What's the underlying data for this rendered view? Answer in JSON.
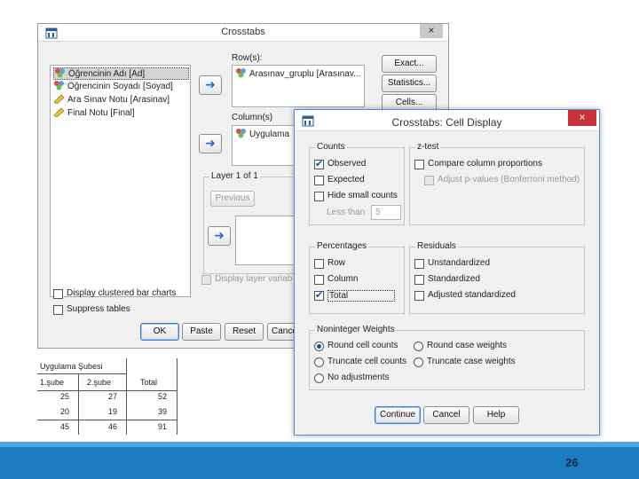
{
  "crosstabs": {
    "title": "Crosstabs",
    "close": "×",
    "variables": [
      "Öğrencinin Adı [Ad]",
      "Öğrencinin Soyadı [Soyad]",
      "Ara Sınav Notu [Arasinav]",
      "Final Notu [Final]"
    ],
    "rows_label": "Row(s):",
    "rows_item": "Arasınav_gruplu [Arasınav...",
    "columns_label": "Column(s)",
    "columns_item": "Uygulama",
    "layer_label": "Layer 1 of 1",
    "previous": "Previous",
    "display_layer": "Display layer variab",
    "clustered": "Display clustered bar charts",
    "suppress": "Suppress tables",
    "side_buttons": [
      "Exact...",
      "Statistics...",
      "Cells..."
    ],
    "bottom_buttons": [
      "OK",
      "Paste",
      "Reset",
      "Cance"
    ]
  },
  "cell_display": {
    "title": "Crosstabs: Cell Display",
    "close": "×",
    "counts": {
      "label": "Counts",
      "observed": "Observed",
      "expected": "Expected",
      "hide_small": "Hide small counts",
      "less_than": "Less than",
      "less_than_value": "5"
    },
    "ztest": {
      "label": "z-test",
      "compare": "Compare column proportions",
      "adjust": "Adjust p-values (Bonferroni method)"
    },
    "percentages": {
      "label": "Percentages",
      "row": "Row",
      "column": "Column",
      "total": "Total"
    },
    "residuals": {
      "label": "Residuals",
      "unstandardized": "Unstandardized",
      "standardized": "Standardized",
      "adjusted": "Adjusted standardized"
    },
    "weights": {
      "label": "Noninteger Weights",
      "round_cell": "Round cell counts",
      "round_case": "Round case weights",
      "truncate_cell": "Truncate cell counts",
      "truncate_case": "Truncate case weights",
      "no_adjust": "No adjustments"
    },
    "buttons": [
      "Continue",
      "Cancel",
      "Help"
    ]
  },
  "result_table": {
    "header": "Uygulama Şubesi",
    "columns": [
      "1.şube",
      "2.şube",
      "Total"
    ],
    "rows": [
      [
        "25",
        "27",
        "52"
      ],
      [
        "20",
        "19",
        "39"
      ],
      [
        "45",
        "46",
        "91"
      ]
    ]
  },
  "slide_number": "26"
}
